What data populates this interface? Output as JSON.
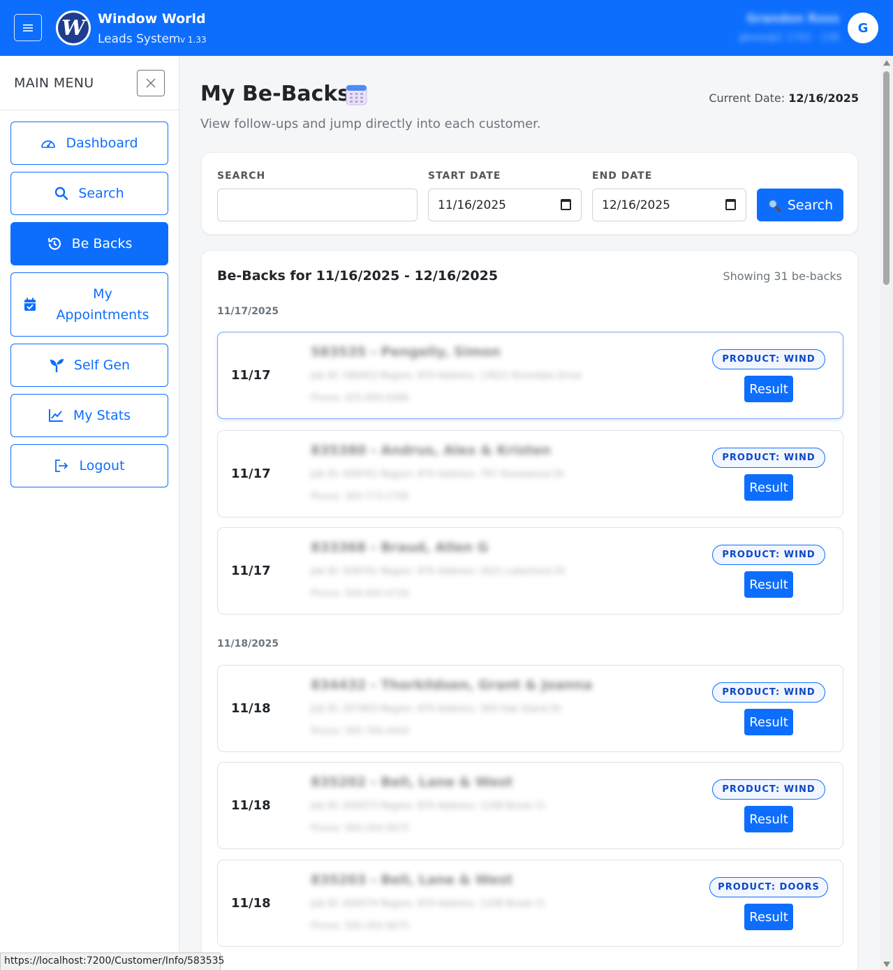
{
  "header": {
    "brand_title": "Window World",
    "brand_subtitle": "Leads System",
    "version": "v 1.33",
    "user_name": "Grandon Ross",
    "user_info": "gboss@1 1702 · 136",
    "avatar_initial": "G",
    "accent": "#0d6efd"
  },
  "sidebar": {
    "title": "MAIN MENU",
    "items": [
      {
        "label": "Dashboard",
        "icon": "gauge-icon"
      },
      {
        "label": "Search",
        "icon": "search-icon"
      },
      {
        "label": "Be Backs",
        "icon": "history-icon",
        "active": true
      },
      {
        "label": "My\nAppointments",
        "icon": "calendar-check-icon"
      },
      {
        "label": "Self Gen",
        "icon": "sprout-icon"
      },
      {
        "label": "My Stats",
        "icon": "chart-line-icon"
      },
      {
        "label": "Logout",
        "icon": "logout-icon"
      }
    ]
  },
  "page": {
    "title": "My Be-Backs",
    "current_date_label": "Current Date:",
    "current_date_value": "12/16/2025",
    "subtitle": "View follow-ups and jump directly into each customer."
  },
  "filters": {
    "search_label": "SEARCH",
    "search_value": "",
    "start_label": "START DATE",
    "start_value": "11/16/2025",
    "end_label": "END DATE",
    "end_value": "12/16/2025",
    "search_button": "Search"
  },
  "results": {
    "title": "Be-Backs for 11/16/2025 - 12/16/2025",
    "count": "Showing 31 be-backs",
    "groups": [
      {
        "date": "11/17/2025"
      },
      {
        "date": "11/18/2025"
      }
    ],
    "rows": [
      {
        "date": "11/17",
        "name": "583535 - Pengelly, Simon",
        "meta": "Job ID: 580953   Region: 870   Address: 13621 Riverdale Drive",
        "phone": "Phone: 425-894-6486",
        "product_label": "PRODUCT:",
        "product": "WIND",
        "result": "Result"
      },
      {
        "date": "11/17",
        "name": "835380 - Andrus, Alex & Kristen",
        "meta": "Job ID: 658761   Region: 870   Address: 797 Stonewood Dr",
        "phone": "Phone: 360-773-2706",
        "product_label": "PRODUCT:",
        "product": "WIND",
        "result": "Result"
      },
      {
        "date": "11/17",
        "name": "833368 - Braud, Allen G",
        "meta": "Job ID: 658741   Region: 870   Address: 2621 Lakeshore Dr",
        "phone": "Phone: 509-905-0726",
        "product_label": "PRODUCT:",
        "product": "WIND",
        "result": "Result"
      },
      {
        "date": "11/18",
        "name": "834432 - Thorkildsen, Grant & Joanna",
        "meta": "Job ID: 657803   Region: 870   Address: 369 Oak Island Dr",
        "phone": "Phone: 585-789-4444",
        "product_label": "PRODUCT:",
        "product": "WIND",
        "result": "Result"
      },
      {
        "date": "11/18",
        "name": "835202 - Bell, Lane & West",
        "meta": "Job ID: 658373   Region: 870   Address: 1108 Brook Ct",
        "phone": "Phone: 585-264-9675",
        "product_label": "PRODUCT:",
        "product": "WIND",
        "result": "Result"
      },
      {
        "date": "11/18",
        "name": "835203 - Bell, Lane & West",
        "meta": "Job ID: 658374   Region: 870   Address: 1108 Brook Ct",
        "phone": "Phone: 585-264-9675",
        "product_label": "PRODUCT:",
        "product": "DOORS",
        "result": "Result"
      }
    ]
  },
  "status_bar": {
    "url": "https://localhost:7200/Customer/Info/583535"
  }
}
